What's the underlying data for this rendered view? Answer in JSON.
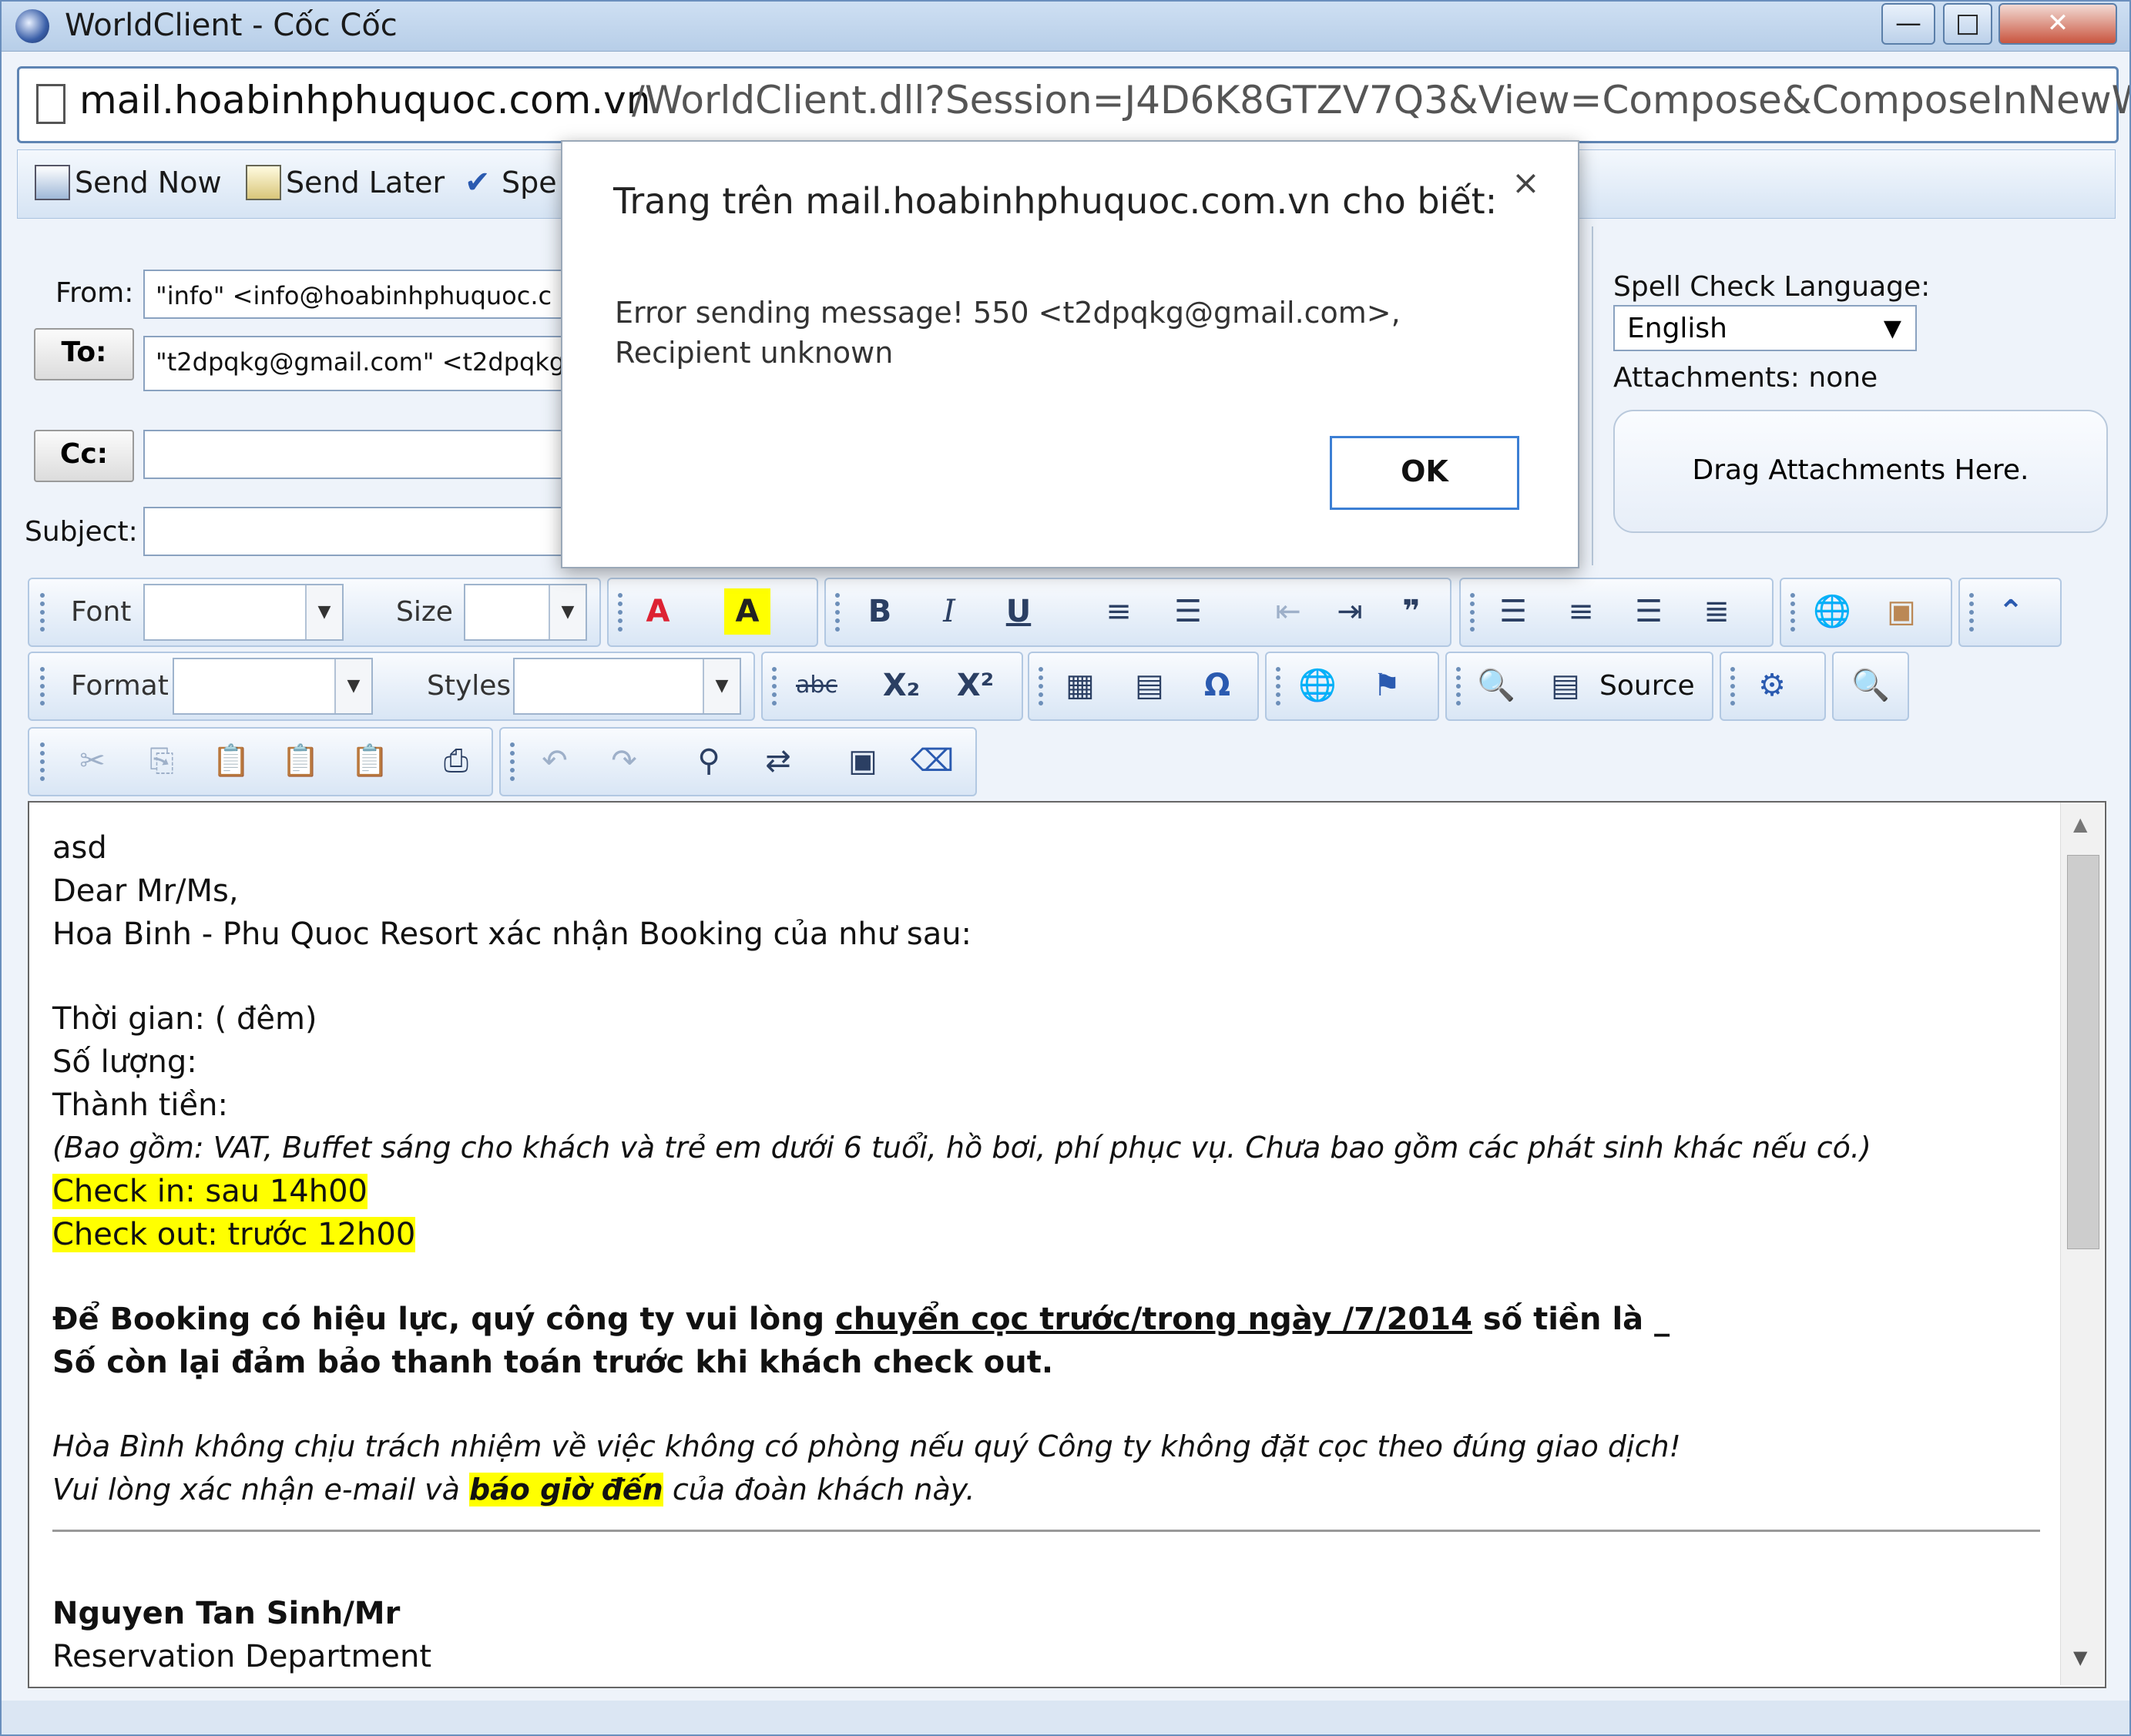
{
  "window": {
    "title": "WorldClient - Cốc Cốc",
    "controls": [
      "—",
      "□",
      "✕"
    ]
  },
  "address": {
    "host": "mail.hoabinhphuquoc.com.vn",
    "rest": "/WorldClient.dll?Session=J4D6K8GTZV7Q3&View=Compose&ComposeInNewW"
  },
  "toolbar": {
    "send_now": "Send Now",
    "send_later": "Send Later",
    "spell": "Spe"
  },
  "form": {
    "from_label": "From:",
    "from_value": "\"info\" <info@hoabinhphuquoc.c",
    "to_label": "To:",
    "to_value": "\"t2dpqkg@gmail.com\" <t2dpqkg",
    "cc_label": "Cc:",
    "cc_value": "",
    "subject_label": "Subject:",
    "subject_value": ""
  },
  "side": {
    "spell_lang_label": "Spell Check Language:",
    "spell_lang_value": "English",
    "attachments": "Attachments: none",
    "drag": "Drag Attachments Here."
  },
  "editor_toolbar": {
    "font_label": "Font",
    "size_label": "Size",
    "format_label": "Format",
    "styles_label": "Styles",
    "source_label": "Source",
    "icons": [
      "font-color",
      "bg-color",
      "bold",
      "italic",
      "underline",
      "numbered-list",
      "bullet-list",
      "outdent",
      "indent",
      "blockquote",
      "align-left",
      "align-center",
      "align-right",
      "justify",
      "link",
      "image",
      "collapse",
      "strike",
      "subscript",
      "superscript",
      "table",
      "horizontal-rule",
      "special-char",
      "anchor",
      "flag",
      "preview",
      "maximize",
      "find-doc",
      "cut",
      "copy",
      "paste",
      "paste-text",
      "paste-word",
      "print",
      "undo",
      "redo",
      "find",
      "replace",
      "select-all",
      "remove-format"
    ],
    "bold": "B",
    "italic": "I",
    "underline": "U",
    "sub": "X₂",
    "sup": "X²",
    "omega": "Ω",
    "strike": "abc"
  },
  "body": {
    "l1": "asd",
    "l2": "Dear Mr/Ms,",
    "l3": "Hoa Binh - Phu Quoc Resort xác nhận Booking của   như sau:",
    "l4": "Thời gian:  (  đêm)",
    "l5": "Số lượng:",
    "l6": "Thành tiền:",
    "l7": "(Bao gồm: VAT, Buffet sáng cho khách và trẻ em dưới 6 tuổi, hồ bơi, phí phục vụ. Chưa bao gồm các phát sinh khác nếu có.)",
    "l8": "Check in:    sau    14h00",
    "l9": "Check out: trước 12h00",
    "l10a": "Để Booking có hiệu lực, quý công ty vui lòng ",
    "l10b": "chuyển cọc trước/trong ngày  /7/2014",
    "l10c": " số tiền là _",
    "l11": "Số còn lại đảm bảo thanh toán trước khi khách check out.",
    "l12": "Hòa Bình không chịu trách nhiệm về việc không có phòng nếu quý Công ty không đặt cọc theo đúng giao dịch!",
    "l13a": "Vui lòng xác nhận e-mail và ",
    "l13b": "báo giờ đến",
    "l13c": " của đoàn khách này.",
    "l14": "Nguyen Tan Sinh/Mr",
    "l15": "Reservation Department"
  },
  "dialog": {
    "title": "Trang trên mail.hoabinhphuquoc.com.vn cho biết:",
    "message": "Error sending message!  550 <t2dpqkg@gmail.com>, Recipient unknown",
    "ok": "OK",
    "close": "×"
  },
  "colors": {
    "highlight": "#ffff00",
    "accent": "#3c7fd4"
  }
}
